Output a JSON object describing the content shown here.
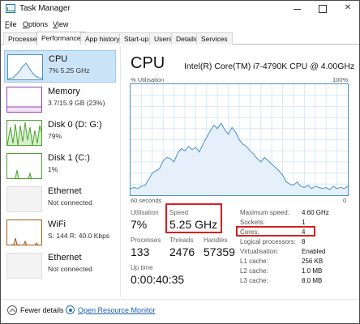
{
  "window": {
    "title": "Task Manager"
  },
  "menu": [
    {
      "label": "File",
      "mnemonic": "F",
      "rest": "ile"
    },
    {
      "label": "Options",
      "mnemonic": "O",
      "rest": "ptions"
    },
    {
      "label": "View",
      "mnemonic": "V",
      "rest": "iew"
    }
  ],
  "tabs": [
    "Processes",
    "Performance",
    "App history",
    "Start-up",
    "Users",
    "Details",
    "Services"
  ],
  "active_tab": "Performance",
  "sidebar": [
    {
      "title": "CPU",
      "sub": "7% 5.25 GHz",
      "sub2": ""
    },
    {
      "title": "Memory",
      "sub": "3.7/15.9 GB (23%)",
      "sub2": ""
    },
    {
      "title": "Disk 0 (D: G:)",
      "sub": "79%",
      "sub2": ""
    },
    {
      "title": "Disk 1 (C:)",
      "sub": "1%",
      "sub2": ""
    },
    {
      "title": "Ethernet",
      "sub": "Not connected",
      "sub2": ""
    },
    {
      "title": "WiFi",
      "sub": "S: 144 R: 40.0 Kbps",
      "sub2": ""
    },
    {
      "title": "Ethernet",
      "sub": "Not connected",
      "sub2": ""
    }
  ],
  "main": {
    "title": "CPU",
    "model": "Intel(R) Core(TM) i7-4790K CPU @ 4.00GHz",
    "util_label": "% Utilisation",
    "max_label": "100%",
    "time_label": "60 seconds",
    "zero_label": "0"
  },
  "stats": {
    "utilisation_label": "Utilisation",
    "utilisation": "7%",
    "speed_label": "Speed",
    "speed": "5.25 GHz",
    "processes_label": "Processes",
    "processes": "133",
    "threads_label": "Threads",
    "threads": "2476",
    "handles_label": "Handles",
    "handles": "57359",
    "uptime_label": "Up time",
    "uptime": "0:00:40:35"
  },
  "details": [
    {
      "label": "Maximum speed:",
      "value": "4.60 GHz"
    },
    {
      "label": "Sockets:",
      "value": "1"
    },
    {
      "label": "Cores:",
      "value": "4"
    },
    {
      "label": "Logical processors:",
      "value": "8"
    },
    {
      "label": "Virtualisation:",
      "value": "Enabled"
    },
    {
      "label": "L1 cache:",
      "value": "256 KB"
    },
    {
      "label": "L2 cache:",
      "value": "1.0 MB"
    },
    {
      "label": "L3 cache:",
      "value": "8.0 MB"
    }
  ],
  "footer": {
    "fewer": "Fewer details",
    "fewer_mnemonic": "d",
    "resource_monitor": "Open Resource Monitor"
  },
  "colors": {
    "cpu_graph": "#4a90c8",
    "cpu_fill": "#e6f0fa",
    "memory": "#9b3fb5",
    "disk": "#4aa32e",
    "network": "#a05a12",
    "highlight": "#d91e1e"
  },
  "cpu_history": [
    6,
    7,
    6,
    8,
    9,
    14,
    20,
    22,
    24,
    31,
    34,
    33,
    30,
    38,
    42,
    40,
    44,
    41,
    43,
    39,
    46,
    52,
    58,
    63,
    60,
    65,
    59,
    55,
    61,
    57,
    50,
    46,
    44,
    40,
    37,
    33,
    30,
    34,
    31,
    28,
    25,
    22,
    18,
    12,
    10,
    9,
    12,
    8,
    7,
    9,
    6,
    8,
    7,
    6,
    7,
    5,
    8,
    6,
    7,
    6,
    8
  ]
}
